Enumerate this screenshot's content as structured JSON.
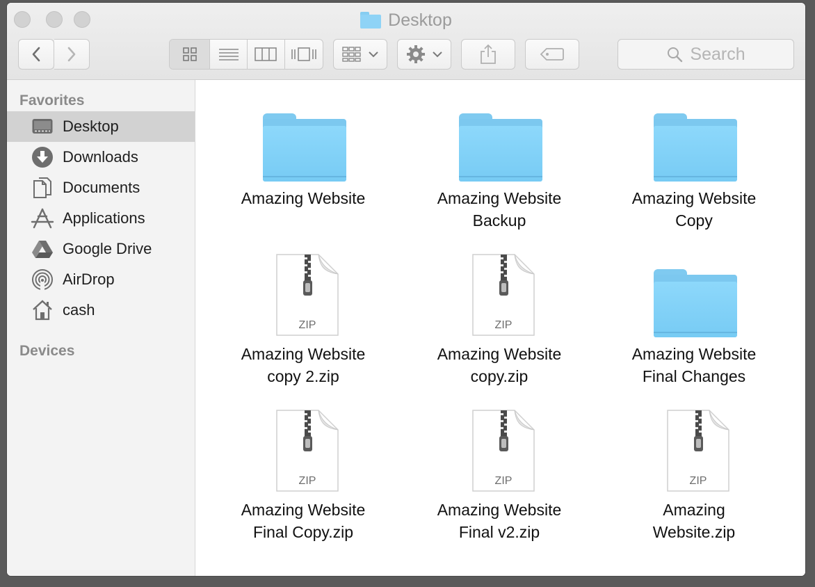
{
  "window": {
    "title": "Desktop"
  },
  "toolbar": {
    "back_icon": "chevron-left-icon",
    "forward_icon": "chevron-right-icon",
    "views": [
      "icon-view",
      "list-view",
      "column-view",
      "cover-flow-view"
    ],
    "active_view": "icon-view",
    "search_placeholder": "Search"
  },
  "sidebar": {
    "favorites_title": "Favorites",
    "devices_title": "Devices",
    "items": [
      {
        "label": "Desktop",
        "icon": "desktop-icon",
        "selected": true
      },
      {
        "label": "Downloads",
        "icon": "downloads-icon"
      },
      {
        "label": "Documents",
        "icon": "documents-icon"
      },
      {
        "label": "Applications",
        "icon": "applications-icon"
      },
      {
        "label": "Google Drive",
        "icon": "google-drive-icon"
      },
      {
        "label": "AirDrop",
        "icon": "airdrop-icon"
      },
      {
        "label": "cash",
        "icon": "home-icon"
      }
    ]
  },
  "files": [
    {
      "line1": "Amazing Website",
      "line2": "",
      "kind": "folder"
    },
    {
      "line1": "Amazing Website",
      "line2": "Backup",
      "kind": "folder"
    },
    {
      "line1": "Amazing Website",
      "line2": "Copy",
      "kind": "folder"
    },
    {
      "line1": "Amazing Website",
      "line2": "copy 2.zip",
      "kind": "zip",
      "badge": "ZIP"
    },
    {
      "line1": "Amazing Website",
      "line2": "copy.zip",
      "kind": "zip",
      "badge": "ZIP"
    },
    {
      "line1": "Amazing Website",
      "line2": "Final Changes",
      "kind": "folder"
    },
    {
      "line1": "Amazing Website",
      "line2": "Final Copy.zip",
      "kind": "zip",
      "badge": "ZIP"
    },
    {
      "line1": "Amazing Website",
      "line2": "Final v2.zip",
      "kind": "zip",
      "badge": "ZIP"
    },
    {
      "line1": "Amazing",
      "line2": "Website.zip",
      "kind": "zip",
      "badge": "ZIP"
    }
  ]
}
